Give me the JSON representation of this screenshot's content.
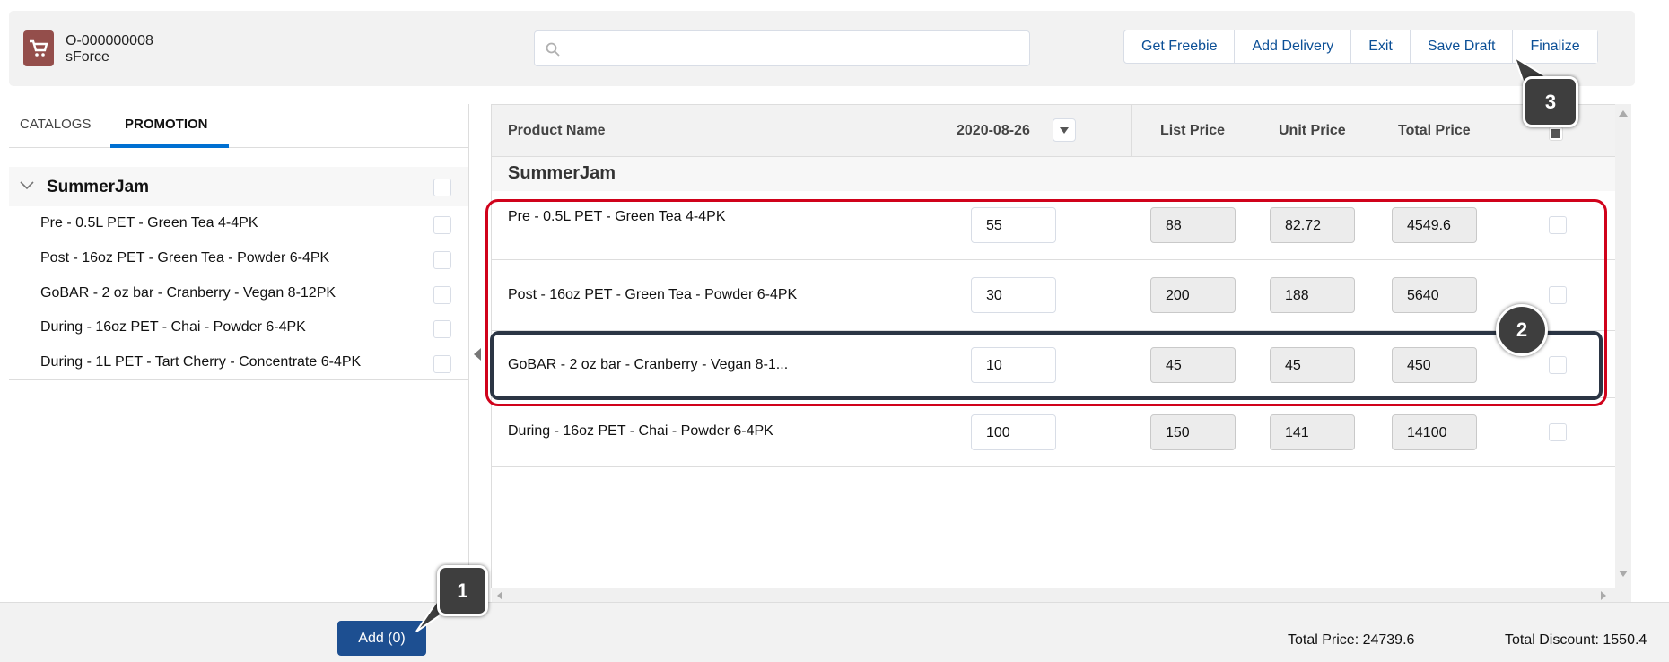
{
  "header": {
    "order_id": "O-000000008",
    "account": "sForce",
    "search_placeholder": "",
    "buttons": [
      "Get Freebie",
      "Add Delivery",
      "Exit",
      "Save Draft",
      "Finalize"
    ]
  },
  "tabs": [
    {
      "label": "CATALOGS",
      "active": false
    },
    {
      "label": "PROMOTION",
      "active": true
    }
  ],
  "sidebar": {
    "group": "SummerJam",
    "items": [
      "Pre - 0.5L PET - Green Tea 4-4PK",
      "Post - 16oz PET - Green Tea - Powder 6-4PK",
      "GoBAR - 2 oz bar - Cranberry - Vegan 8-12PK",
      "During - 16oz PET - Chai - Powder 6-4PK",
      "During - 1L PET - Tart Cherry - Concentrate 6-4PK"
    ]
  },
  "table": {
    "headers": {
      "product": "Product Name",
      "date": "2020-08-26",
      "list": "List Price",
      "unit": "Unit Price",
      "total": "Total Price"
    },
    "group": "SummerJam",
    "rows": [
      {
        "name": "Pre - 0.5L PET - Green Tea 4-4PK",
        "qty": "55",
        "list": "88",
        "unit": "82.72",
        "total": "4549.6"
      },
      {
        "name": "Post - 16oz PET - Green Tea - Powder 6-4PK",
        "qty": "30",
        "list": "200",
        "unit": "188",
        "total": "5640"
      },
      {
        "name": "GoBAR - 2 oz bar - Cranberry - Vegan 8-1...",
        "qty": "10",
        "list": "45",
        "unit": "45",
        "total": "450"
      },
      {
        "name": "During - 16oz PET - Chai - Powder 6-4PK",
        "qty": "100",
        "list": "150",
        "unit": "141",
        "total": "14100"
      }
    ]
  },
  "footer": {
    "add_label": "Add (0)",
    "total_price": "Total Price: 24739.6",
    "total_discount": "Total Discount: 1550.4"
  },
  "annotations": [
    "1",
    "2",
    "3"
  ],
  "colors": {
    "brand_icon": "#944e4b",
    "accent": "#0070d2",
    "add_button": "#1d4f91",
    "highlight_red": "#d0021b",
    "highlight_dark": "#2b3544"
  }
}
